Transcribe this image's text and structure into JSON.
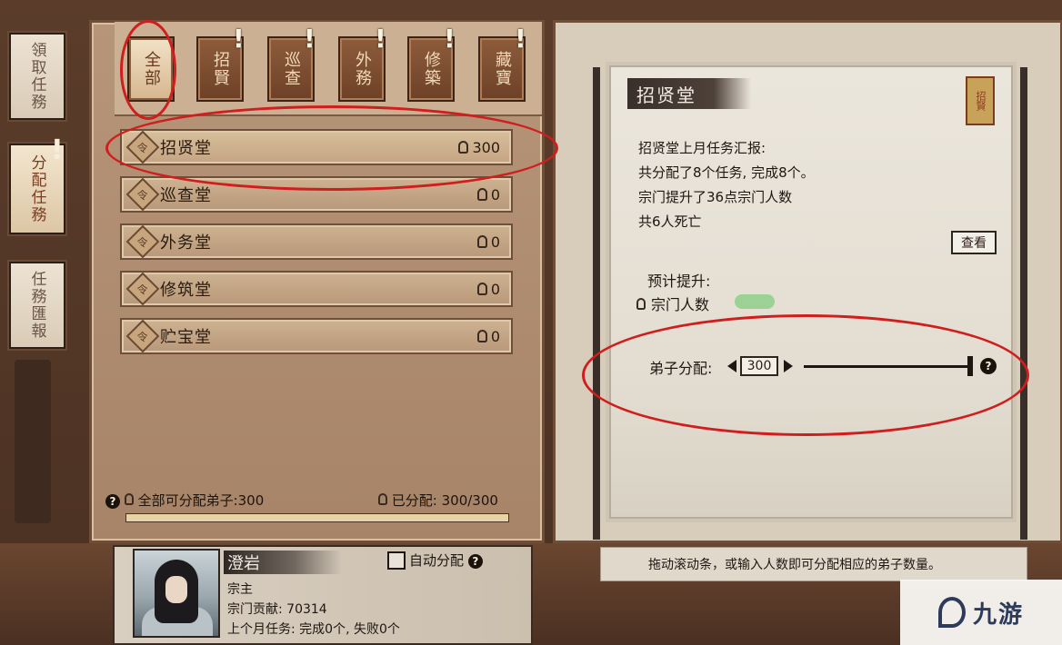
{
  "side_tabs": [
    {
      "label": "領取任務"
    },
    {
      "label": "分配任務"
    },
    {
      "label": "任務匯報"
    }
  ],
  "categories": [
    {
      "label": "全部",
      "active": true,
      "alert": false
    },
    {
      "label": "招賢",
      "active": false,
      "alert": true
    },
    {
      "label": "巡查",
      "active": false,
      "alert": true
    },
    {
      "label": "外務",
      "active": false,
      "alert": true
    },
    {
      "label": "修築",
      "active": false,
      "alert": true
    },
    {
      "label": "藏寶",
      "active": false,
      "alert": true
    }
  ],
  "halls": [
    {
      "name": "招贤堂",
      "count": "300",
      "active": true
    },
    {
      "name": "巡查堂",
      "count": "0",
      "active": false
    },
    {
      "name": "外务堂",
      "count": "0",
      "active": false
    },
    {
      "name": "修筑堂",
      "count": "0",
      "active": false
    },
    {
      "name": "贮宝堂",
      "count": "0",
      "active": false
    }
  ],
  "footer": {
    "available": "全部可分配弟子:300",
    "assigned": "已分配: 300/300"
  },
  "detail": {
    "title": "招贤堂",
    "seal": "招賢",
    "report_lines": [
      "招贤堂上月任务汇报:",
      "共分配了8个任务, 完成8个。",
      "宗门提升了36点宗门人数",
      "共6人死亡"
    ],
    "view_button": "查看",
    "forecast_label": "预计提升:",
    "forecast_item": "宗门人数",
    "alloc_label": "弟子分配:",
    "alloc_value": "300"
  },
  "character": {
    "name": "澄岩",
    "role": "宗主",
    "contribution": "宗门贡献: 70314",
    "last_month": "上个月任务: 完成0个, 失败0个",
    "auto_assign": "自动分配"
  },
  "hint": "拖动滚动条，或输入人数即可分配相应的弟子数量。",
  "watermark": "九游",
  "accent_colors": {
    "highlight_oval": "#d01d1d"
  }
}
